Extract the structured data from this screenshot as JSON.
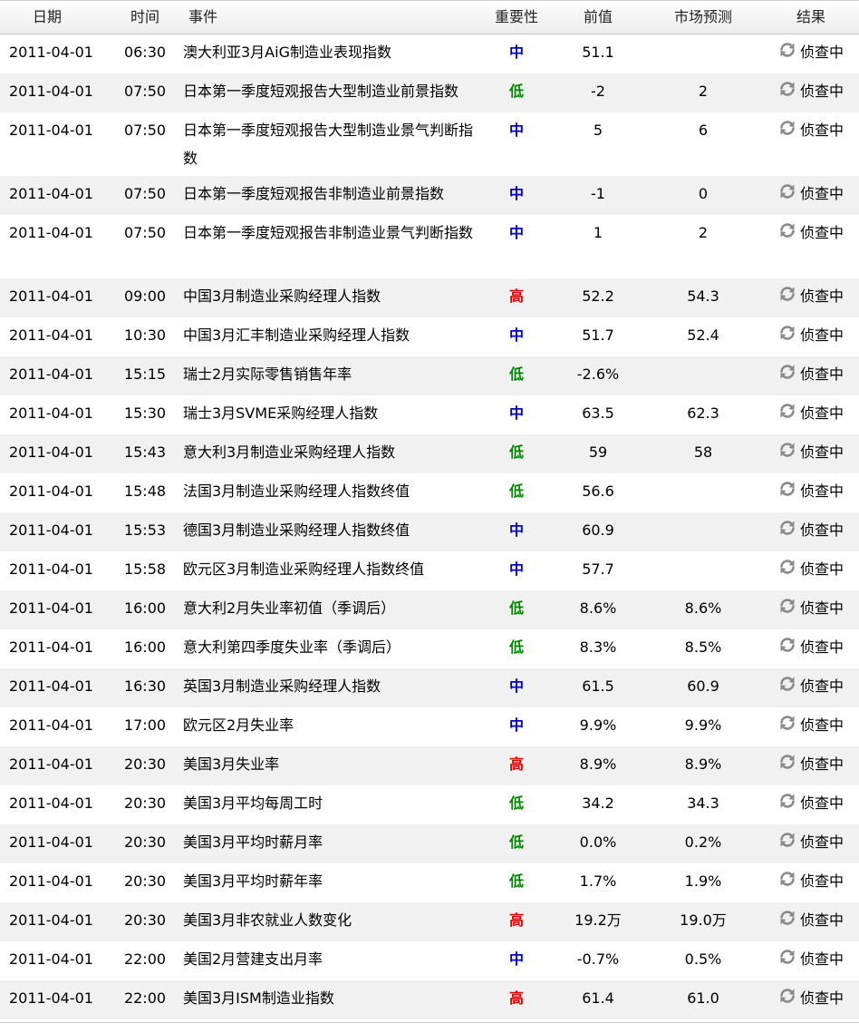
{
  "header": {
    "date": "日期",
    "time": "时间",
    "event": "事件",
    "importance": "重要性",
    "previous": "前值",
    "forecast": "市场预测",
    "result": "结果"
  },
  "rows": [
    {
      "date": "2011-04-01",
      "time": "06:30",
      "event": "澳大利亚3月AiG制造业表现指数",
      "importance": "中",
      "previous": "51.1",
      "forecast": "",
      "result": "侦查中"
    },
    {
      "date": "2011-04-01",
      "time": "07:50",
      "event": "日本第一季度短观报告大型制造业前景指数",
      "importance": "低",
      "previous": "-2",
      "forecast": "2",
      "result": "侦查中"
    },
    {
      "date": "2011-04-01",
      "time": "07:50",
      "event": "日本第一季度短观报告大型制造业景气判断指数",
      "importance": "中",
      "previous": "5",
      "forecast": "6",
      "result": "侦查中"
    },
    {
      "date": "2011-04-01",
      "time": "07:50",
      "event": "日本第一季度短观报告非制造业前景指数",
      "importance": "中",
      "previous": "-1",
      "forecast": "0",
      "result": "侦查中"
    },
    {
      "date": "2011-04-01",
      "time": "07:50",
      "event": "日本第一季度短观报告非制造业景气判断指数",
      "importance": "中",
      "previous": "1",
      "forecast": "2",
      "result": "侦查中"
    },
    {
      "date": "2011-04-01",
      "time": "09:00",
      "event": "中国3月制造业采购经理人指数",
      "importance": "高",
      "previous": "52.2",
      "forecast": "54.3",
      "result": "侦查中"
    },
    {
      "date": "2011-04-01",
      "time": "10:30",
      "event": "中国3月汇丰制造业采购经理人指数",
      "importance": "中",
      "previous": "51.7",
      "forecast": "52.4",
      "result": "侦查中"
    },
    {
      "date": "2011-04-01",
      "time": "15:15",
      "event": "瑞士2月实际零售销售年率",
      "importance": "低",
      "previous": "-2.6%",
      "forecast": "",
      "result": "侦查中"
    },
    {
      "date": "2011-04-01",
      "time": "15:30",
      "event": "瑞士3月SVME采购经理人指数",
      "importance": "中",
      "previous": "63.5",
      "forecast": "62.3",
      "result": "侦查中"
    },
    {
      "date": "2011-04-01",
      "time": "15:43",
      "event": "意大利3月制造业采购经理人指数",
      "importance": "低",
      "previous": "59",
      "forecast": "58",
      "result": "侦查中"
    },
    {
      "date": "2011-04-01",
      "time": "15:48",
      "event": "法国3月制造业采购经理人指数终值",
      "importance": "低",
      "previous": "56.6",
      "forecast": "",
      "result": "侦查中"
    },
    {
      "date": "2011-04-01",
      "time": "15:53",
      "event": "德国3月制造业采购经理人指数终值",
      "importance": "中",
      "previous": "60.9",
      "forecast": "",
      "result": "侦查中"
    },
    {
      "date": "2011-04-01",
      "time": "15:58",
      "event": "欧元区3月制造业采购经理人指数终值",
      "importance": "中",
      "previous": "57.7",
      "forecast": "",
      "result": "侦查中"
    },
    {
      "date": "2011-04-01",
      "time": "16:00",
      "event": "意大利2月失业率初值（季调后）",
      "importance": "低",
      "previous": "8.6%",
      "forecast": "8.6%",
      "result": "侦查中"
    },
    {
      "date": "2011-04-01",
      "time": "16:00",
      "event": "意大利第四季度失业率（季调后）",
      "importance": "低",
      "previous": "8.3%",
      "forecast": "8.5%",
      "result": "侦查中"
    },
    {
      "date": "2011-04-01",
      "time": "16:30",
      "event": "英国3月制造业采购经理人指数",
      "importance": "中",
      "previous": "61.5",
      "forecast": "60.9",
      "result": "侦查中"
    },
    {
      "date": "2011-04-01",
      "time": "17:00",
      "event": "欧元区2月失业率",
      "importance": "中",
      "previous": "9.9%",
      "forecast": "9.9%",
      "result": "侦查中"
    },
    {
      "date": "2011-04-01",
      "time": "20:30",
      "event": "美国3月失业率",
      "importance": "高",
      "previous": "8.9%",
      "forecast": "8.9%",
      "result": "侦查中"
    },
    {
      "date": "2011-04-01",
      "time": "20:30",
      "event": "美国3月平均每周工时",
      "importance": "低",
      "previous": "34.2",
      "forecast": "34.3",
      "result": "侦查中"
    },
    {
      "date": "2011-04-01",
      "time": "20:30",
      "event": "美国3月平均时薪月率",
      "importance": "低",
      "previous": "0.0%",
      "forecast": "0.2%",
      "result": "侦查中"
    },
    {
      "date": "2011-04-01",
      "time": "20:30",
      "event": "美国3月平均时薪年率",
      "importance": "低",
      "previous": "1.7%",
      "forecast": "1.9%",
      "result": "侦查中"
    },
    {
      "date": "2011-04-01",
      "time": "20:30",
      "event": "美国3月非农就业人数变化",
      "importance": "高",
      "previous": "19.2万",
      "forecast": "19.0万",
      "result": "侦查中"
    },
    {
      "date": "2011-04-01",
      "time": "22:00",
      "event": "美国2月营建支出月率",
      "importance": "中",
      "previous": "-0.7%",
      "forecast": "0.5%",
      "result": "侦查中"
    },
    {
      "date": "2011-04-01",
      "time": "22:00",
      "event": "美国3月ISM制造业指数",
      "importance": "高",
      "previous": "61.4",
      "forecast": "61.0",
      "result": "侦查中"
    }
  ],
  "importance_colors": {
    "高": "#e00000",
    "中": "#0000cc",
    "低": "#008800"
  },
  "result_icon": "refresh-icon"
}
